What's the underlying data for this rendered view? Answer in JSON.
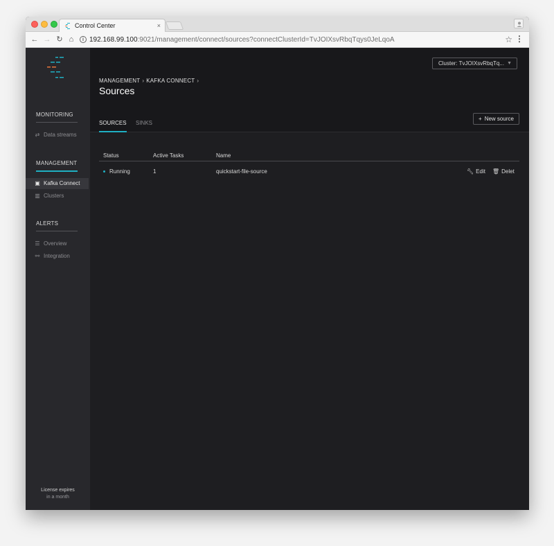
{
  "browser": {
    "tab_title": "Control Center",
    "tab_close": "×",
    "url_host": "192.168.99.100",
    "url_rest": ":9021/management/connect/sources?connectClusterId=TvJOIXsvRbqTqys0JeLqoA"
  },
  "sidebar": {
    "sections": [
      {
        "label": "MONITORING",
        "items": [
          {
            "label": "Data streams",
            "icon": "arrows-icon"
          }
        ]
      },
      {
        "label": "MANAGEMENT",
        "items": [
          {
            "label": "Kafka Connect",
            "icon": "connect-icon"
          },
          {
            "label": "Clusters",
            "icon": "clusters-icon"
          }
        ]
      },
      {
        "label": "ALERTS",
        "items": [
          {
            "label": "Overview",
            "icon": "list-icon"
          },
          {
            "label": "Integration",
            "icon": "integration-icon"
          }
        ]
      }
    ],
    "license_line1": "License expires",
    "license_line2": "in a month"
  },
  "header": {
    "cluster_select": "Cluster: TvJOIXsvRbqTq...",
    "breadcrumb": [
      "MANAGEMENT",
      "KAFKA CONNECT"
    ],
    "title": "Sources",
    "tabs": [
      "SOURCES",
      "SINKS"
    ],
    "new_source": "New source"
  },
  "table": {
    "columns": [
      "Status",
      "Active Tasks",
      "Name"
    ],
    "rows": [
      {
        "status": "Running",
        "active_tasks": "1",
        "name": "quickstart-file-source",
        "edit": "Edit",
        "delete": "Delet"
      }
    ]
  },
  "colors": {
    "accent": "#1fb0c3",
    "sidebar_bg": "#28282c",
    "main_bg": "#1e1e21"
  }
}
